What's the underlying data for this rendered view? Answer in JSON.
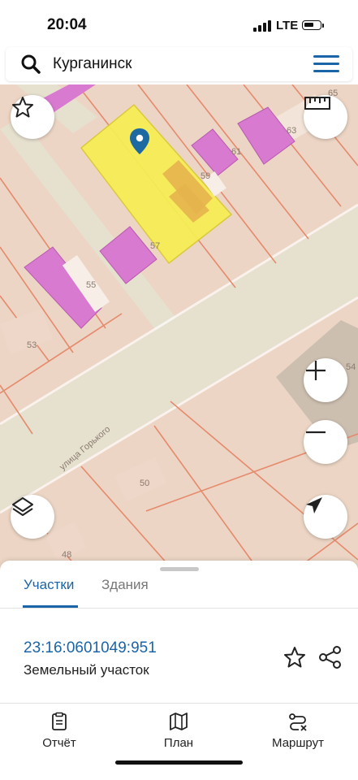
{
  "status_bar": {
    "time": "20:04",
    "network": "LTE",
    "icons": [
      "signal-icon",
      "battery-icon"
    ]
  },
  "search": {
    "value": "Курганинск",
    "icon": "search-icon",
    "menu_icon": "menu-icon"
  },
  "map": {
    "house_numbers": [
      "65",
      "63",
      "61",
      "59",
      "57",
      "55",
      "53",
      "50",
      "48",
      "54"
    ],
    "street_name": "улица Горького",
    "selected_parcel_color": "#f7ef53",
    "building_color": "#d97ad1",
    "parcel_border_color": "#e58a6c",
    "road_color": "#e8e2d1",
    "controls": [
      "star-icon",
      "ruler-icon",
      "zoom-in-icon",
      "zoom-out-icon",
      "layers-icon",
      "locate-arrow-icon"
    ]
  },
  "sheet": {
    "tabs": [
      "Участки",
      "Здания"
    ],
    "active_tab": "Участки",
    "cadastral_number": "23:16:0601049:951",
    "parcel_type": "Земельный участок"
  },
  "bottom_nav": [
    {
      "label": "Отчёт",
      "icon": "report-icon"
    },
    {
      "label": "План",
      "icon": "map-plan-icon"
    },
    {
      "label": "Маршрут",
      "icon": "route-icon"
    }
  ],
  "colors": {
    "accent": "#1a64a8",
    "map_background": "#ecd5c4"
  }
}
